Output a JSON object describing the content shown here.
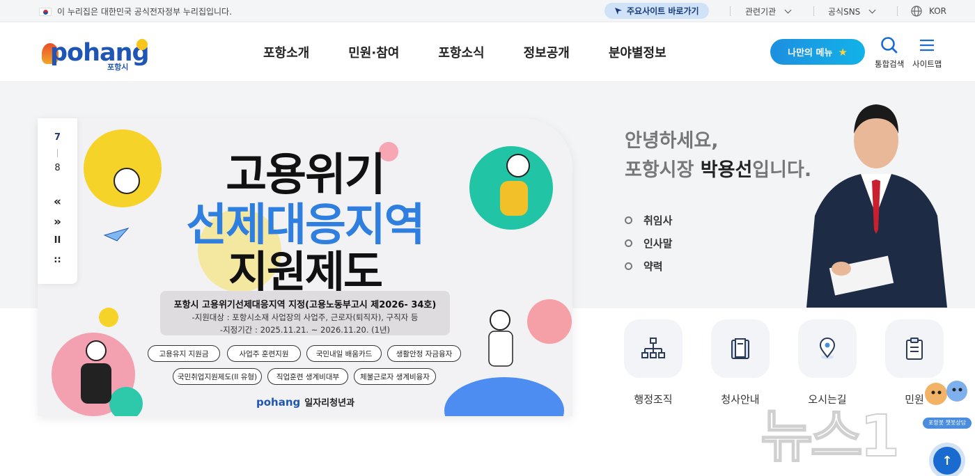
{
  "topbar": {
    "gov_notice": "이 누리집은 대한민국 공식전자정부 누리집입니다.",
    "quick_link": "주요사이트 바로가기",
    "related": "관련기관",
    "sns": "공식SNS",
    "lang": "KOR"
  },
  "header": {
    "logo_text": "pohang",
    "logo_sub": "포항시",
    "nav": [
      "포항소개",
      "민원·참여",
      "포항소식",
      "정보공개",
      "분야별정보"
    ],
    "my_menu": "나만의 메뉴",
    "search_label": "통합검색",
    "sitemap_label": "사이트맵"
  },
  "slider": {
    "current": "7",
    "total": "8",
    "prev": "«",
    "next": "»",
    "pause": "II",
    "all": "::"
  },
  "banner": {
    "title_line1": "고용위기",
    "title_line2": "선제대응지역",
    "title_line3": "지원제도",
    "notice_title": "포항시 고용위기선제대응지역 지정(고용노동부고시 제2026- 34호)",
    "notice_target": "-지원대상 : 포항시소재 사업장의 사업주, 근로자(퇴직자), 구직자 등",
    "notice_period": "-지정기간 : 2025.11.21. ~ 2026.11.20. (1년)",
    "pills": [
      "고용유지 지원금",
      "사업주 훈련지원",
      "국민내일 배움카드",
      "생활안정 자금융자",
      "국민취업지원제도(II 유형)",
      "직업훈련 생계비대부",
      "체불근로자 생계비융자"
    ],
    "footer_logo": "pohang",
    "footer_dept": "일자리청년과"
  },
  "mayor": {
    "greeting_line1": "안녕하세요,",
    "greeting_prefix": "포항시장 ",
    "greeting_name": "박용선",
    "greeting_suffix": "입니다.",
    "links": [
      "취임사",
      "인사말",
      "약력"
    ]
  },
  "services": [
    "행정조직",
    "청사안내",
    "오시는길",
    "민원"
  ],
  "watermark": "뉴스1",
  "chatbot_label": "포항봇 챗봇상담",
  "colors": {
    "brand_blue": "#1f56b5",
    "accent_blue": "#2f7fe0",
    "mymenu_gradient": "#1d8fe0"
  }
}
